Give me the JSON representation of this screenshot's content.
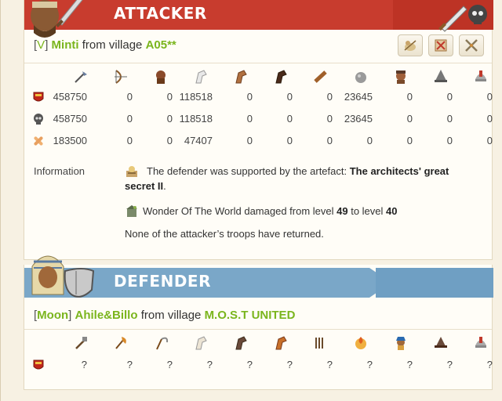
{
  "attacker": {
    "banner_title": "ATTACKER",
    "player_open": "[",
    "player_tag": "V",
    "player_close": "]",
    "player_name": "Minti",
    "from_text": "from village",
    "village": "A05**",
    "action_icons": [
      "trade-route-icon",
      "simulator-icon",
      "attack-again-icon"
    ],
    "unit_icons": [
      "clubswinger-icon",
      "bow-icon",
      "tribesman-icon",
      "horse-icon",
      "mounted-scout-icon",
      "dark-horse-icon",
      "ram-icon",
      "catapult-icon",
      "chief-icon",
      "settler-icon",
      "hero-helmet-icon"
    ],
    "rows": [
      {
        "icon": "troops-shield-icon",
        "values": [
          "458750",
          "0",
          "0",
          "118518",
          "0",
          "0",
          "0",
          "23645",
          "0",
          "0",
          "0"
        ]
      },
      {
        "icon": "skull-icon",
        "values": [
          "458750",
          "0",
          "0",
          "118518",
          "0",
          "0",
          "0",
          "23645",
          "0",
          "0",
          "0"
        ]
      },
      {
        "icon": "bandage-icon",
        "values": [
          "183500",
          "0",
          "0",
          "47407",
          "0",
          "0",
          "0",
          "0",
          "0",
          "0",
          "0"
        ]
      }
    ],
    "information_label": "Information",
    "info_line1_pre": "The defender was supported by the artefact: ",
    "info_line1_bold": "The architects' great",
    "info_line1_bold2": "secret II",
    "info_line1_post": ".",
    "info_line2_pre": "Wonder Of The World damaged from level ",
    "info_line2_from": "49",
    "info_line2_mid": " to level ",
    "info_line2_to": "40",
    "info_line3": "None of the attacker’s troops have returned."
  },
  "defender": {
    "banner_title": "DEFENDER",
    "player_open": "[",
    "player_tag": "Moon",
    "player_close": "]",
    "player_name": "Ahile&Billo",
    "from_text": "from village",
    "village": "M.O.S.T UNITED",
    "unit_icons": [
      "legionnaire-icon",
      "axe-icon",
      "scythe-icon",
      "white-horse-icon",
      "brown-horse-icon",
      "orange-horse-icon",
      "battering-ram-icon",
      "fire-catapult-icon",
      "senator-icon",
      "settler-hat-icon",
      "hero-helmet-icon"
    ],
    "row_icon": "troops-shield-icon",
    "values": [
      "?",
      "?",
      "?",
      "?",
      "?",
      "?",
      "?",
      "?",
      "?",
      "?",
      "?"
    ]
  },
  "colors": {
    "attacker_red": "#c83c2e",
    "defender_blue": "#7aa7c8",
    "player_green": "#7ab51d"
  }
}
